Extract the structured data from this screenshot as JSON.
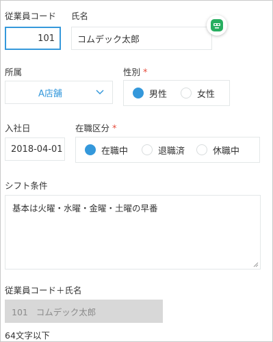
{
  "form": {
    "employee_code": {
      "label": "従業員コード",
      "value": "101"
    },
    "name": {
      "label": "氏名",
      "value": "コムデック太郎"
    },
    "department": {
      "label": "所属",
      "selected": "A店舗"
    },
    "gender": {
      "label": "性別",
      "required_mark": "*",
      "options": [
        {
          "label": "男性",
          "checked": true
        },
        {
          "label": "女性",
          "checked": false
        }
      ]
    },
    "hire_date": {
      "label": "入社日",
      "value": "2018-04-01"
    },
    "employment_status": {
      "label": "在職区分",
      "required_mark": "*",
      "options": [
        {
          "label": "在職中",
          "checked": true
        },
        {
          "label": "退職済",
          "checked": false
        },
        {
          "label": "休職中",
          "checked": false
        }
      ]
    },
    "shift_conditions": {
      "label": "シフト条件",
      "value": "基本は火曜・水曜・金曜・土曜の早番"
    },
    "code_plus_name": {
      "label": "従業員コード＋氏名",
      "value": "101   コムデック太郎",
      "hint": "64文字以下"
    }
  },
  "colors": {
    "accent": "#3498db",
    "required": "#e74c3c",
    "widget_green": "#27ae60",
    "readonly_bg": "#d8d8d8"
  },
  "icons": {
    "dropdown": "chevron-down-icon",
    "widget": "robot-icon",
    "resize": "resize-grip-icon"
  }
}
